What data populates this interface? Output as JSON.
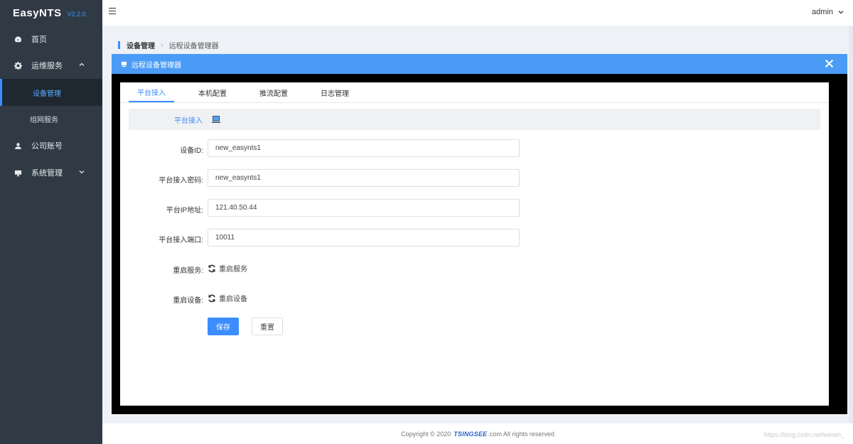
{
  "app": {
    "name": "EasyNTS",
    "version": "V2.2.0"
  },
  "sidebar": {
    "items": [
      {
        "label": "首页",
        "icon": "dashboard-icon"
      },
      {
        "label": "运维服务",
        "icon": "gear-icon"
      },
      {
        "label": "设备管理",
        "active": true
      },
      {
        "label": "组网服务"
      },
      {
        "label": "公司账号",
        "icon": "user-icon"
      },
      {
        "label": "系统管理",
        "icon": "monitor-icon"
      }
    ]
  },
  "topbar": {
    "user": "admin"
  },
  "breadcrumb": {
    "parent": "设备管理",
    "current": "远程设备管理器"
  },
  "panel": {
    "title": "远程设备管理器"
  },
  "tabs": [
    "平台接入",
    "本机配置",
    "推流配置",
    "日志管理"
  ],
  "section": {
    "title": "平台接入"
  },
  "form": {
    "device_id": {
      "label": "设备ID:",
      "value": "new_easynts1"
    },
    "password": {
      "label": "平台接入密码:",
      "value": "new_easynts1"
    },
    "ip": {
      "label": "平台IP地址:",
      "value": "121.40.50.44"
    },
    "port": {
      "label": "平台接入端口:",
      "value": "10011"
    },
    "restart_service": {
      "label": "重启服务:",
      "action": "重启服务"
    },
    "restart_device": {
      "label": "重启设备:",
      "action": "重启设备"
    },
    "save": "保存",
    "reset": "重置"
  },
  "footer": {
    "prefix": "Copyright © 2020",
    "brand": "TSINGSEE",
    "suffix": ".com All rights reserved"
  },
  "watermark": "https://blog.csdn.net/weixin_"
}
